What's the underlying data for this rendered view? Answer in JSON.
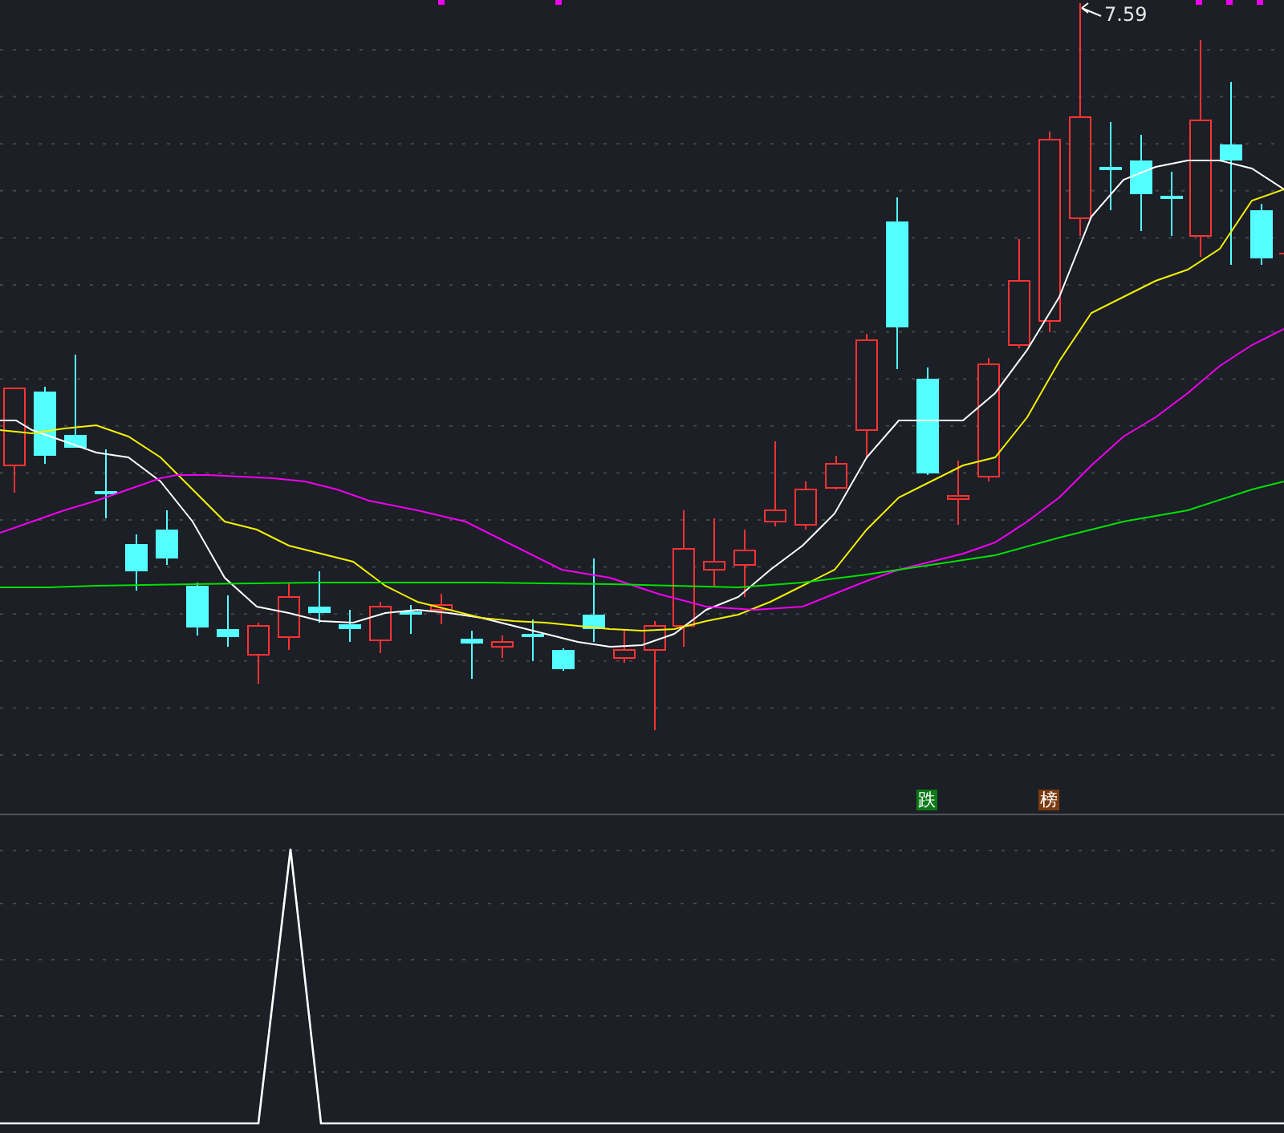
{
  "main_chart": {
    "high_label": {
      "text": "7.59"
    },
    "markers": [
      {
        "text": "跌",
        "color": "#0b7a16"
      },
      {
        "text": "榜",
        "color": "#7b3b10"
      }
    ]
  }
}
